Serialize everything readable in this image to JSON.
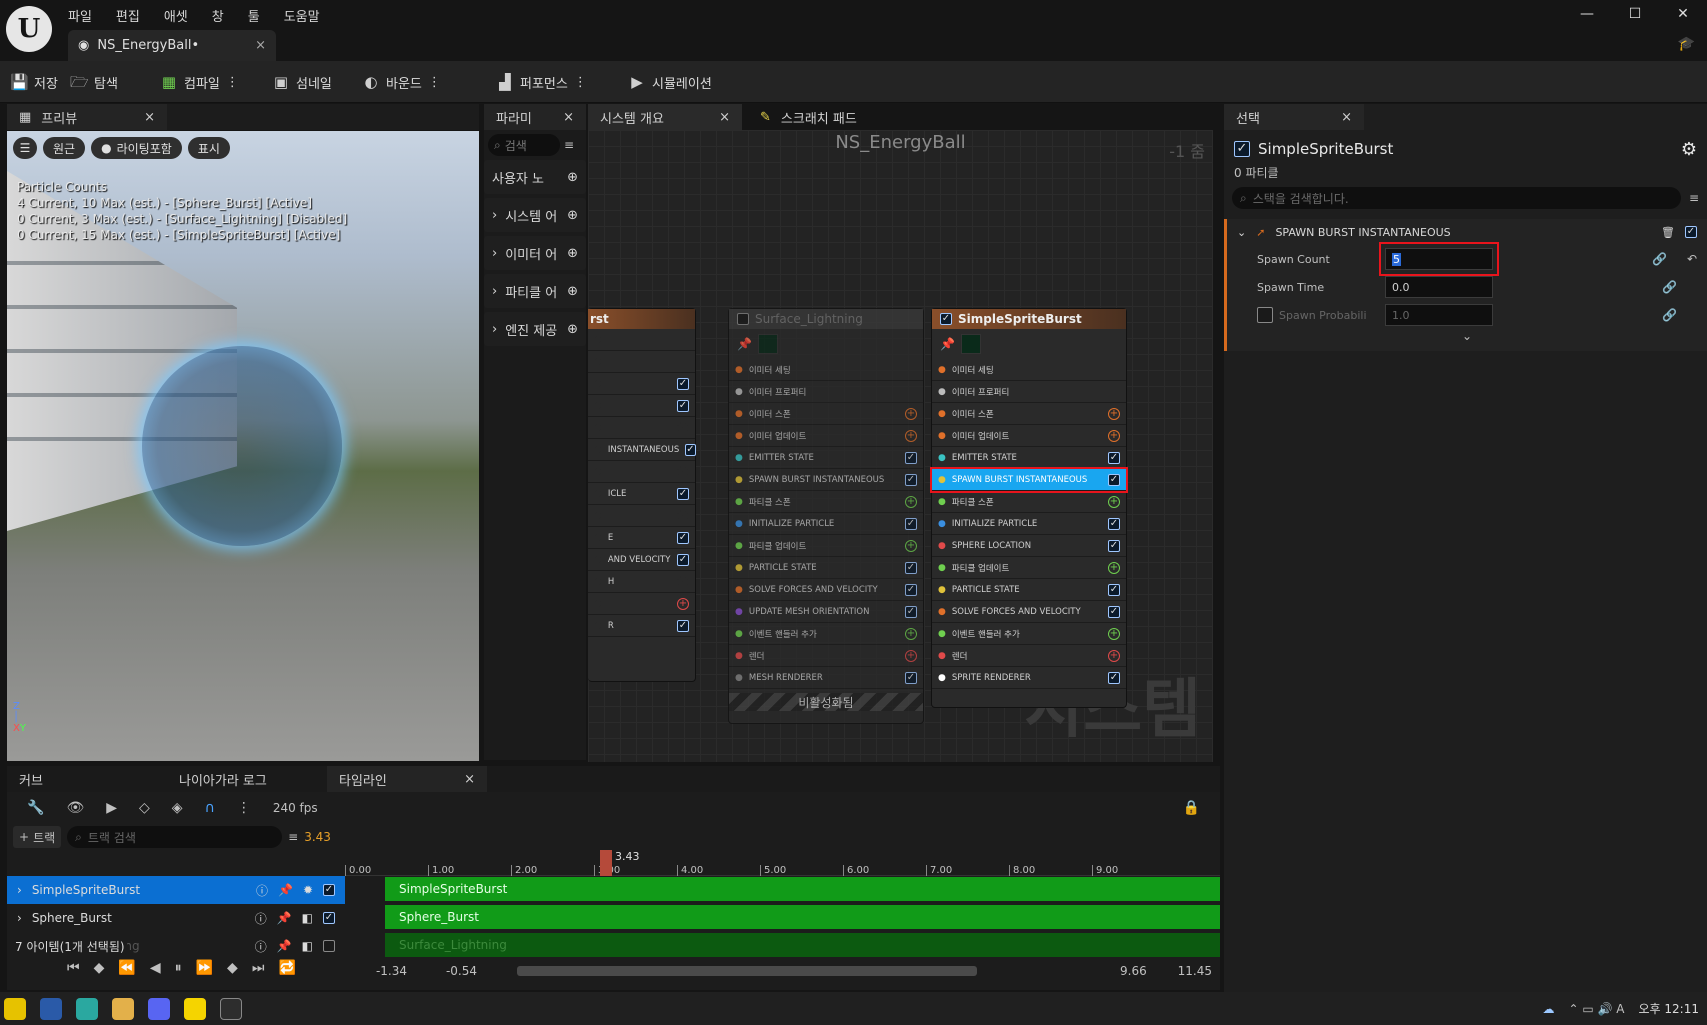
{
  "menu": [
    "파일",
    "편집",
    "애셋",
    "창",
    "툴",
    "도움말"
  ],
  "doc_tab": "NS_EnergyBall•",
  "toolbar": {
    "save": "저장",
    "browse": "탐색",
    "compile": "컴파일",
    "thumbnail": "섬네일",
    "bounds": "바운드",
    "performance": "퍼포먼스",
    "simulation": "시뮬레이션"
  },
  "preview": {
    "tab": "프리뷰",
    "btn_perspective": "원근",
    "btn_lit": "라이팅포함",
    "btn_show": "표시",
    "counts": [
      "Particle Counts",
      "4 Current, 10 Max (est.) - [Sphere_Burst] [Active]",
      "0 Current, 3 Max (est.) - [Surface_Lightning] [Disabled]",
      "0 Current, 15 Max (est.) - [SimpleSpriteBurst] [Active]"
    ]
  },
  "params": {
    "tab": "파라미",
    "search": "검색",
    "sections": [
      "사용자 노",
      "시스템 어",
      "이미터 어",
      "파티클 어",
      "엔진 제공"
    ]
  },
  "graph": {
    "tab_overview": "시스템 개요",
    "tab_scratch": "스크래치 패드",
    "title": "NS_EnergyBall",
    "zoom": "-1 줌",
    "watermark": "시스템",
    "disabled_label": "비활성화됨"
  },
  "node_left": {
    "title": "rst",
    "rows": [
      "",
      "",
      "",
      "",
      "",
      "INSTANTANEOUS",
      "",
      "ICLE",
      "",
      "E",
      "AND VELOCITY",
      "H",
      "",
      "R"
    ]
  },
  "node_mid": {
    "title": "Surface_Lightning",
    "rows": [
      "이미터 세팅",
      "이미터 프로퍼티",
      "이미터 스폰",
      "이미터 업데이트",
      "EMITTER STATE",
      "SPAWN BURST INSTANTANEOUS",
      "파티클 스폰",
      "INITIALIZE PARTICLE",
      "파티클 업데이트",
      "PARTICLE STATE",
      "SOLVE FORCES AND VELOCITY",
      "UPDATE MESH ORIENTATION",
      "이벤트 핸들러 추가",
      "렌더",
      "MESH RENDERER"
    ]
  },
  "node_right": {
    "title": "SimpleSpriteBurst",
    "rows": [
      "이미터 세팅",
      "이미터 프로퍼티",
      "이미터 스폰",
      "이미터 업데이트",
      "EMITTER STATE",
      "SPAWN BURST INSTANTANEOUS",
      "파티클 스폰",
      "INITIALIZE PARTICLE",
      "SPHERE LOCATION",
      "파티클 업데이트",
      "PARTICLE STATE",
      "SOLVE FORCES AND VELOCITY",
      "이벤트 핸들러 추가",
      "렌더",
      "SPRITE RENDERER"
    ]
  },
  "selection": {
    "tab": "선택",
    "emitter": "SimpleSpriteBurst",
    "particles": "0 파티클",
    "search": "스택을 검색합니다.",
    "module": "SPAWN BURST INSTANTANEOUS",
    "fields": [
      {
        "label": "Spawn Count",
        "value": "5"
      },
      {
        "label": "Spawn Time",
        "value": "0.0"
      },
      {
        "label": "Spawn Probabili",
        "value": "1.0"
      }
    ]
  },
  "bottom_tabs": [
    "커브",
    "나이아가라 로그",
    "타임라인"
  ],
  "timeline": {
    "fps": "240 fps",
    "add_track": "트랙",
    "search": "트랙 검색",
    "current_time": "3.43",
    "items_label": "7 아이템(1개 선택됨)",
    "tracks": [
      "SimpleSpriteBurst",
      "Sphere_Burst",
      "Surface_Lightning"
    ],
    "ticks": [
      "0.00",
      "1.00",
      "2.00",
      "3.00",
      "4.00",
      "5.00",
      "6.00",
      "7.00",
      "8.00",
      "9.00"
    ],
    "range": [
      "-1.34",
      "-0.54",
      "9.66",
      "11.45"
    ]
  },
  "clock": "오후 12:11"
}
